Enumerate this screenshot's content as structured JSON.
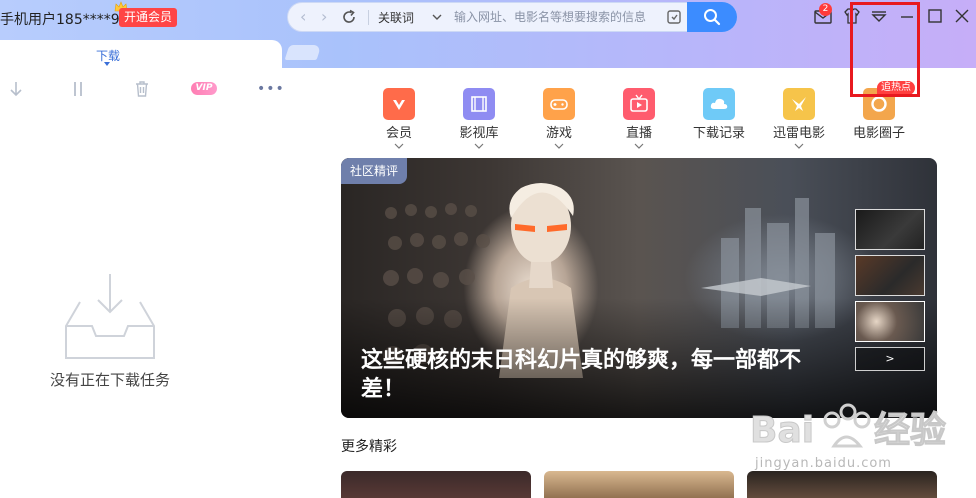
{
  "titlebar": {
    "user_name": "手机用户185****9...",
    "vip_button": "开通会员",
    "address_bar": {
      "mode": "关联词",
      "placeholder": "输入网址、电影名等想要搜索的信息"
    },
    "mail_count": "2"
  },
  "tabs": {
    "active": "下载"
  },
  "toolbar": {
    "vip_label": "VIP",
    "more_label": "•••"
  },
  "download_pane": {
    "empty_text": "没有正在下载任务"
  },
  "nav": {
    "items": [
      {
        "label": "会员",
        "color": "#ff6b4a"
      },
      {
        "label": "影视库",
        "color": "#8f8cf2"
      },
      {
        "label": "游戏",
        "color": "#ffa24a"
      },
      {
        "label": "直播",
        "color": "#ff5c6e"
      },
      {
        "label": "下载记录",
        "color": "#6fcaf7"
      },
      {
        "label": "迅雷电影",
        "color": "#f6c44a"
      },
      {
        "label": "电影圈子",
        "color": "#f3a64c"
      }
    ],
    "hot_badge": "追热点"
  },
  "banner": {
    "tag": "社区精评",
    "title": "这些硬核的末日科幻片真的够爽，每一部都不差！",
    "next_label": ">"
  },
  "more": {
    "title": "更多精彩"
  },
  "watermark": {
    "logo": "Baidu经验",
    "url": "jingyan.baidu.com"
  },
  "colors": {
    "accent": "#3c8cff",
    "vip_red": "#ff4545",
    "highlight": "#e8191f"
  }
}
